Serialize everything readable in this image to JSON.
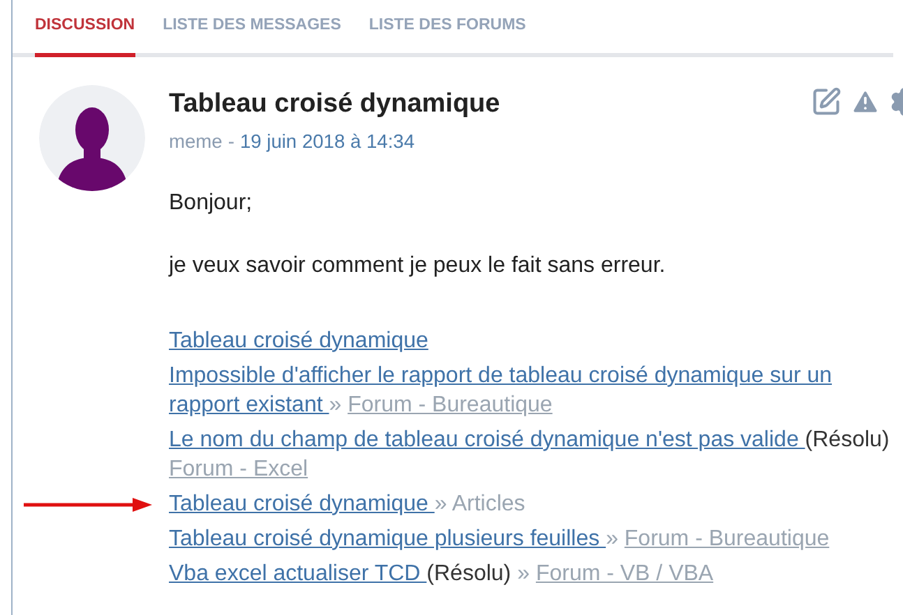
{
  "tabs": [
    {
      "label": "DISCUSSION",
      "selected": true
    },
    {
      "label": "LISTE DES MESSAGES",
      "selected": false
    },
    {
      "label": "LISTE DES FORUMS",
      "selected": false
    }
  ],
  "post": {
    "title": "Tableau croisé dynamique",
    "author": "meme",
    "separator": "-",
    "date": "19 juin 2018 à 14:34",
    "paragraphs": [
      "Bonjour;",
      "je veux savoir comment je peux le fait sans erreur."
    ]
  },
  "related": [
    {
      "title": "Tableau croisé dynamique",
      "arrow": false
    },
    {
      "title": "Impossible d'afficher le rapport de tableau croisé dynamique sur un rapport existant ",
      "separator": "»",
      "category": "Forum - Bureautique",
      "category_link": true,
      "arrow": false
    },
    {
      "title": "Le nom du champ de tableau croisé dynamique n'est pas valide ",
      "status": "(Résolu)",
      "category": "Forum - Excel",
      "category_link": true,
      "arrow": false
    },
    {
      "title": "Tableau croisé dynamique ",
      "separator": "»",
      "category": "Articles",
      "category_link": false,
      "arrow": true
    },
    {
      "title": "Tableau croisé dynamique plusieurs feuilles ",
      "separator": "»",
      "category": "Forum - Bureautique",
      "category_link": true,
      "arrow": false
    },
    {
      "title": "Vba excel actualiser TCD ",
      "status": "(Résolu)",
      "separator": "»",
      "category": "Forum - VB / VBA",
      "category_link": true,
      "arrow": false
    }
  ]
}
